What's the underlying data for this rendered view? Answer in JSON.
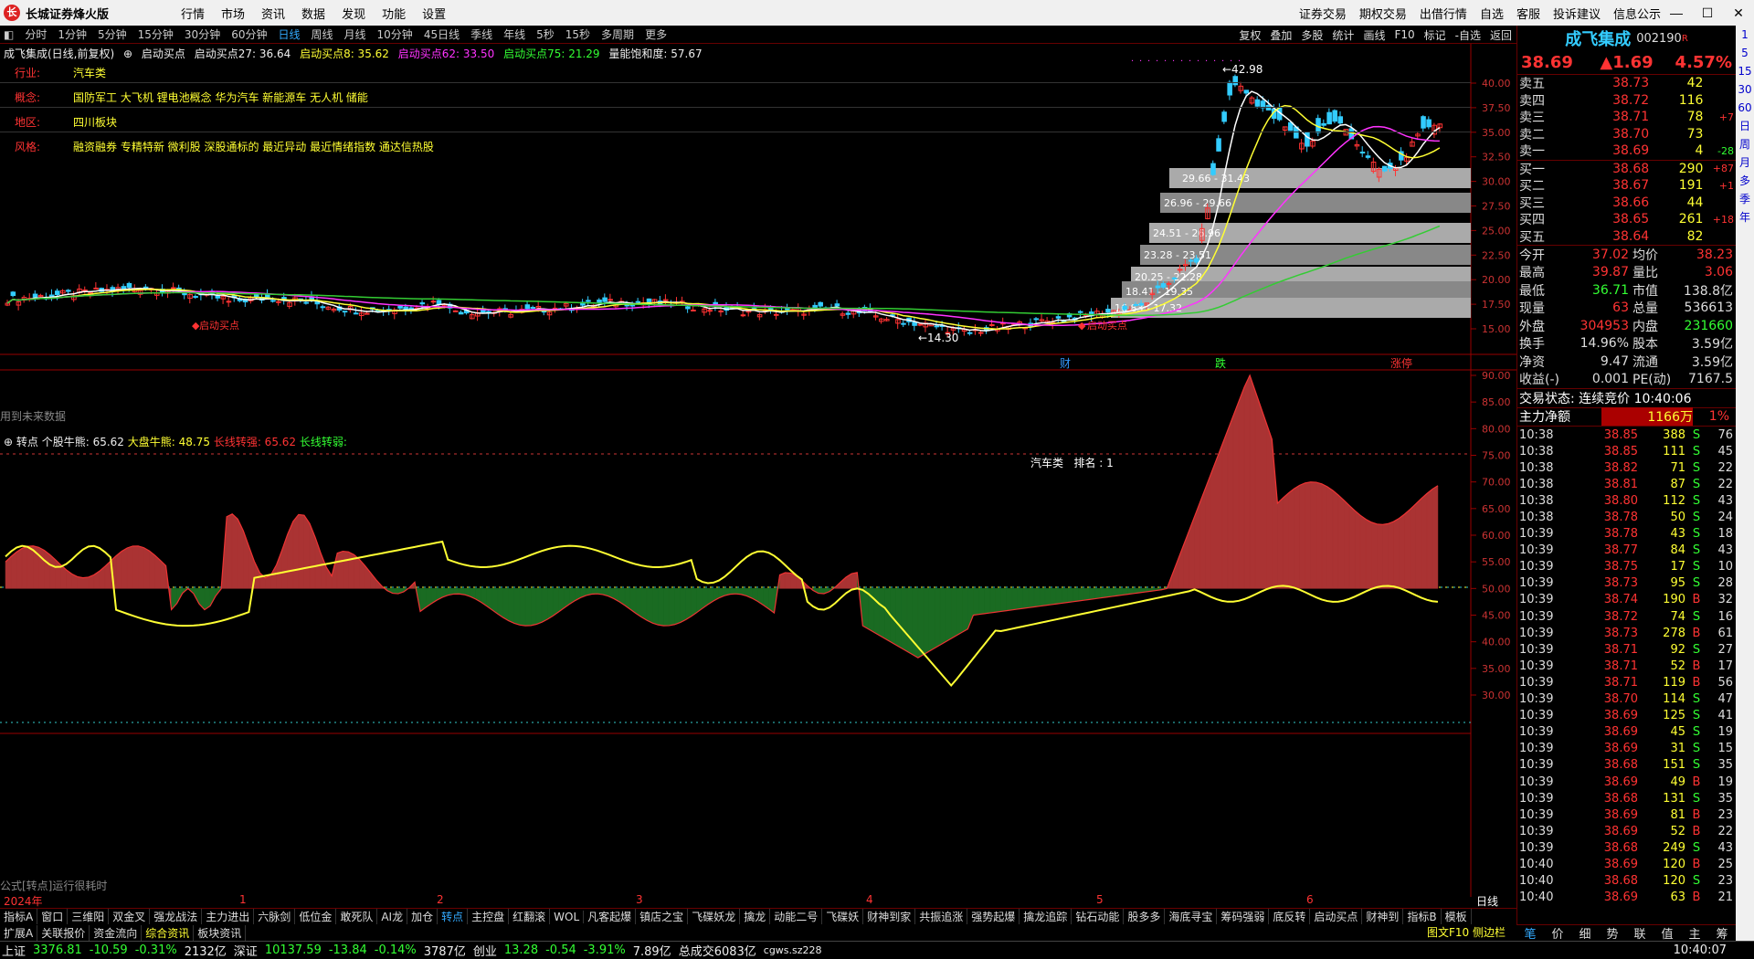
{
  "app": {
    "title": "长城证券烽火版",
    "menu": [
      "行情",
      "市场",
      "资讯",
      "数据",
      "发现",
      "功能",
      "设置"
    ],
    "right_links": [
      "证券交易",
      "期权交易",
      "出借行情",
      "自选",
      "客服",
      "投诉建议",
      "信息公示"
    ]
  },
  "periods": [
    "分时",
    "1分钟",
    "5分钟",
    "15分钟",
    "30分钟",
    "60分钟",
    "日线",
    "周线",
    "月线",
    "10分钟",
    "45日线",
    "季线",
    "年线",
    "5秒",
    "15秒",
    "多周期",
    "更多"
  ],
  "active_period": "日线",
  "tools": [
    "复权",
    "叠加",
    "多股",
    "统计",
    "画线",
    "F10",
    "标记",
    "-自选",
    "返回"
  ],
  "main_header": {
    "name": "成飞集成(日线,前复权)",
    "ind": "启动买点",
    "v1": "启动买点27: 36.64",
    "v2": "启动买点8: 35.62",
    "v3": "启动买点62: 33.50",
    "v4": "启动买点75: 21.29",
    "v5": "量能饱和度: 57.67"
  },
  "info": [
    {
      "k": "行业:",
      "v": "汽车类"
    },
    {
      "k": "概念:",
      "v": "国防军工 大飞机 锂电池概念 华为汽车 新能源车 无人机 储能"
    },
    {
      "k": "地区:",
      "v": "四川板块"
    },
    {
      "k": "风格:",
      "v": "融资融券 专精特新 微利股 深股通标的 最近异动 最近情绪指数 通达信热股"
    }
  ],
  "price_axis": [
    "40.00",
    "37.50",
    "35.00",
    "32.50",
    "30.00",
    "27.50",
    "25.00",
    "22.50",
    "20.00",
    "17.50",
    "15.00"
  ],
  "annotations": {
    "high": "42.98",
    "low": "14.30",
    "future": "用到未来数据",
    "bottom_markers": [
      "财",
      "跌",
      "涨停"
    ],
    "signal1": "启动买点",
    "signal2": "启动买点"
  },
  "zones": [
    "29.66 - 31.43",
    "26.96 - 29.66",
    "24.51 - 26.96",
    "23.28 - 23.51",
    "20.25 - 22.28",
    "18.41 - 19.35",
    "16.83 - 17.32"
  ],
  "sub_header": {
    "name": "转点",
    "a": "个股牛熊: 65.62",
    "b": "大盘牛熊: 48.75",
    "c": "长线转强: 65.62",
    "d": "长线转弱:"
  },
  "sub_label": "汽车类   排名 : 1",
  "sub_axis": [
    "90.00",
    "85.00",
    "80.00",
    "75.00",
    "70.00",
    "65.00",
    "60.00",
    "55.00",
    "50.00",
    "45.00",
    "40.00",
    "35.00",
    "30.00"
  ],
  "sub_footer": "公式[转点]运行很耗时",
  "months": [
    "2024年",
    "1",
    "2",
    "3",
    "4",
    "5",
    "6"
  ],
  "tabs1": [
    "指标A",
    "窗口",
    "三维阳",
    "双金叉",
    "强龙战法",
    "主力进出",
    "六脉剑",
    "低位金",
    "敢死队",
    "AI龙",
    "加仓",
    "转点",
    "主控盘",
    "红翻滚",
    "WOL",
    "凡客起爆",
    "镇店之宝",
    "飞碟妖龙",
    "擒龙",
    "动能二号",
    "飞碟妖",
    "财神到家",
    "共振追涨",
    "强势起爆",
    "擒龙追踪",
    "钻石动能",
    "股多多",
    "海底寻宝",
    "筹码强弱",
    "底反转",
    "启动买点",
    "财神到",
    "指标B",
    "模板"
  ],
  "tabs1_active": "转点",
  "tabs2": [
    "扩展A",
    "关联报价",
    "资金流向",
    "综合资讯",
    "板块资讯"
  ],
  "tabs2_active": "综合资讯",
  "right_small": "图文F10",
  "right_small2": "侧边栏",
  "day_line": "日线",
  "status": {
    "sh_name": "上证",
    "sh_val": "3376.81",
    "sh_chg": "-10.59",
    "sh_pct": "-0.31%",
    "sh_amt": "2132亿",
    "sz_name": "深证",
    "sz_val": "10137.59",
    "sz_chg": "-13.84",
    "sz_pct": "-0.14%",
    "sz_amt": "3787亿",
    "cy_name": "创业",
    "cy_val": "13.28",
    "cy_chg": "-0.54",
    "cy_pct": "-3.91%",
    "cy_amt": "7.89亿",
    "total": "总成交6083亿",
    "server": "cgws.sz228",
    "time": "10:40:07"
  },
  "quote": {
    "name": "成飞集成",
    "code": "002190",
    "r": "R",
    "price": "38.69",
    "chg": "▲1.69",
    "pct": "4.57%"
  },
  "asks": [
    {
      "l": "卖五",
      "p": "38.73",
      "v": "42",
      "c": ""
    },
    {
      "l": "卖四",
      "p": "38.72",
      "v": "116",
      "c": ""
    },
    {
      "l": "卖三",
      "p": "38.71",
      "v": "78",
      "c": "+7"
    },
    {
      "l": "卖二",
      "p": "38.70",
      "v": "73",
      "c": ""
    },
    {
      "l": "卖一",
      "p": "38.69",
      "v": "4",
      "c": "-28"
    }
  ],
  "bids": [
    {
      "l": "买一",
      "p": "38.68",
      "v": "290",
      "c": "+87"
    },
    {
      "l": "买二",
      "p": "38.67",
      "v": "191",
      "c": "+1"
    },
    {
      "l": "买三",
      "p": "38.66",
      "v": "44",
      "c": ""
    },
    {
      "l": "买四",
      "p": "38.65",
      "v": "261",
      "c": "+18"
    },
    {
      "l": "买五",
      "p": "38.64",
      "v": "82",
      "c": ""
    }
  ],
  "stats": [
    [
      "今开",
      "37.02",
      "均价",
      "38.23"
    ],
    [
      "最高",
      "39.87",
      "量比",
      "3.06"
    ],
    [
      "最低",
      "36.71",
      "市值",
      "138.8亿"
    ],
    [
      "现量",
      "63",
      "总量",
      "536613"
    ],
    [
      "外盘",
      "304953",
      "内盘",
      "231660"
    ],
    [
      "换手",
      "14.96%",
      "股本",
      "3.59亿"
    ],
    [
      "净资",
      "9.47",
      "流通",
      "3.59亿"
    ],
    [
      "收益(-)",
      "0.001",
      "PE(动)",
      "7167.5"
    ]
  ],
  "trade_state": "交易状态: 连续竞价 10:40:06",
  "net_flow": {
    "label": "主力净额",
    "val": "1166万",
    "pct": "1%"
  },
  "ticks": [
    [
      "10:38",
      "38.85",
      "388",
      "S",
      "76"
    ],
    [
      "10:38",
      "38.85",
      "111",
      "S",
      "45"
    ],
    [
      "10:38",
      "38.82",
      "71",
      "S",
      "22"
    ],
    [
      "10:38",
      "38.81",
      "87",
      "S",
      "22"
    ],
    [
      "10:38",
      "38.80",
      "112",
      "S",
      "43"
    ],
    [
      "10:38",
      "38.78",
      "50",
      "S",
      "24"
    ],
    [
      "10:39",
      "38.78",
      "43",
      "S",
      "18"
    ],
    [
      "10:39",
      "38.77",
      "84",
      "S",
      "43"
    ],
    [
      "10:39",
      "38.75",
      "17",
      "S",
      "10"
    ],
    [
      "10:39",
      "38.73",
      "95",
      "S",
      "28"
    ],
    [
      "10:39",
      "38.74",
      "190",
      "B",
      "32"
    ],
    [
      "10:39",
      "38.72",
      "74",
      "S",
      "16"
    ],
    [
      "10:39",
      "38.73",
      "278",
      "B",
      "61"
    ],
    [
      "10:39",
      "38.71",
      "92",
      "S",
      "27"
    ],
    [
      "10:39",
      "38.71",
      "52",
      "B",
      "17"
    ],
    [
      "10:39",
      "38.71",
      "119",
      "B",
      "56"
    ],
    [
      "10:39",
      "38.70",
      "114",
      "S",
      "47"
    ],
    [
      "10:39",
      "38.69",
      "125",
      "S",
      "41"
    ],
    [
      "10:39",
      "38.69",
      "45",
      "S",
      "19"
    ],
    [
      "10:39",
      "38.69",
      "31",
      "S",
      "15"
    ],
    [
      "10:39",
      "38.68",
      "151",
      "S",
      "35"
    ],
    [
      "10:39",
      "38.69",
      "49",
      "B",
      "19"
    ],
    [
      "10:39",
      "38.68",
      "131",
      "S",
      "35"
    ],
    [
      "10:39",
      "38.69",
      "81",
      "B",
      "23"
    ],
    [
      "10:39",
      "38.69",
      "52",
      "B",
      "22"
    ],
    [
      "10:39",
      "38.68",
      "249",
      "S",
      "43"
    ],
    [
      "10:40",
      "38.69",
      "120",
      "B",
      "25"
    ],
    [
      "10:40",
      "38.68",
      "120",
      "S",
      "23"
    ],
    [
      "10:40",
      "38.69",
      "63",
      "B",
      "21"
    ]
  ],
  "rtabs": [
    "笔",
    "价",
    "细",
    "势",
    "联",
    "值",
    "主",
    "筹"
  ],
  "rtabs_active": "笔",
  "sidebar": [
    "1",
    "5",
    "15",
    "30",
    "60",
    "日",
    "周",
    "月",
    "多",
    "季",
    "年"
  ]
}
